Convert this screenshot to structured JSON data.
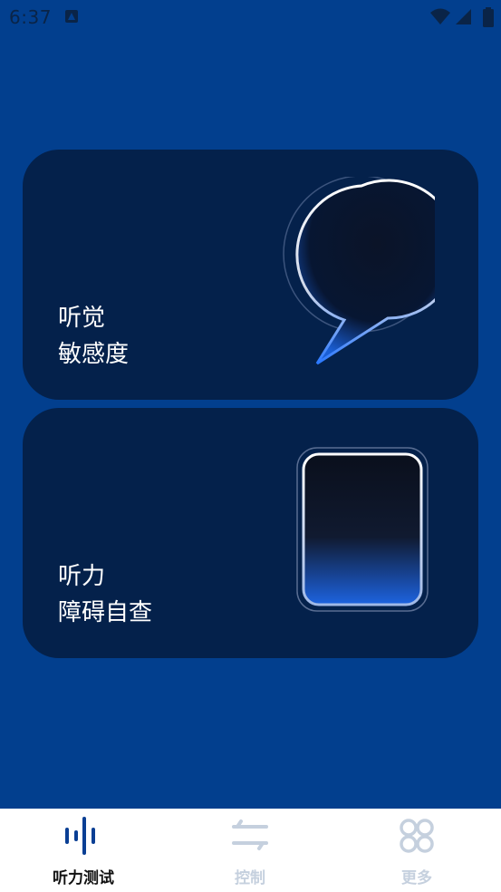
{
  "status_bar": {
    "time": "6:37",
    "icons": [
      "app-notification-icon",
      "wifi-icon",
      "cellular-signal-icon",
      "battery-icon"
    ]
  },
  "cards": [
    {
      "line1": "听觉",
      "line2": "敏感度",
      "icon": "sound-wave-speech-bubble-icon"
    },
    {
      "line1": "听力",
      "line2": "障碍自查",
      "icon": "document-lines-icon"
    }
  ],
  "bottom_nav": {
    "items": [
      {
        "label": "听力测试",
        "icon": "audio-bars-icon",
        "active": true
      },
      {
        "label": "控制",
        "icon": "sliders-arrows-icon",
        "active": false
      },
      {
        "label": "更多",
        "icon": "four-circles-grid-icon",
        "active": false
      }
    ]
  },
  "colors": {
    "background": "#023f8e",
    "card": "#04214b",
    "accent": "#1f6fe8",
    "nav_active_icon": "#0a3f94",
    "nav_inactive": "#c5d0de"
  }
}
